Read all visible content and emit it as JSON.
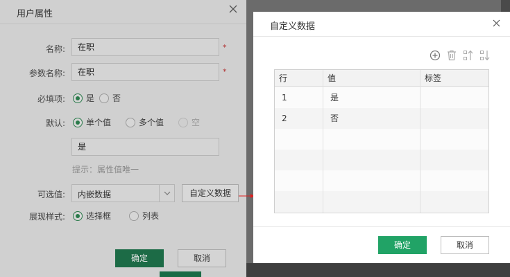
{
  "left_dialog": {
    "title": "用户属性",
    "fields": {
      "name_label": "名称:",
      "name_value": "在职",
      "param_label": "参数名称:",
      "param_value": "在职",
      "required_label": "必填项:",
      "required_yes": "是",
      "required_no": "否",
      "default_label": "默认:",
      "default_single": "单个值",
      "default_multi": "多个值",
      "default_empty": "空",
      "default_value": "是",
      "hint": "提示：属性值唯一",
      "options_label": "可选值:",
      "options_value": "内嵌数据",
      "custom_button": "自定义数据",
      "display_label": "展现样式:",
      "display_select": "选择框",
      "display_list": "列表"
    },
    "required_mark": "*",
    "ok_button": "确定",
    "cancel_button": "取消"
  },
  "right_dialog": {
    "title": "自定义数据",
    "toolbar": [
      "add-icon",
      "delete-icon",
      "move-up-icon",
      "move-down-icon"
    ],
    "columns": [
      "行",
      "值",
      "标签"
    ],
    "rows": [
      {
        "row": "1",
        "value": "是",
        "label": ""
      },
      {
        "row": "2",
        "value": "否",
        "label": ""
      }
    ],
    "ok_button": "确定",
    "cancel_button": "取消"
  },
  "colors": {
    "accent_green": "#21a366",
    "arrow_red": "#e02020"
  }
}
